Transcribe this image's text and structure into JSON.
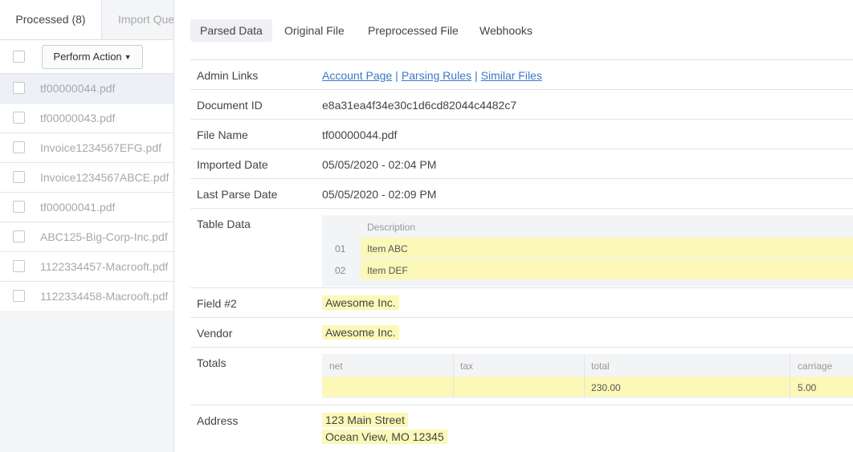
{
  "left": {
    "tabs": {
      "processed": "Processed (8)",
      "import_queue": "Import Queue"
    },
    "perform_action": "Perform Action",
    "files": [
      "tf00000044.pdf",
      "tf00000043.pdf",
      "Invoice1234567EFG.pdf",
      "Invoice1234567ABCE.pdf",
      "tf00000041.pdf",
      "ABC125-Big-Corp-Inc.pdf",
      "1122334457-Macrooft.pdf",
      "1122334458-Macrooft.pdf"
    ]
  },
  "right": {
    "tabs": [
      "Parsed Data",
      "Original File",
      "Preprocessed File",
      "Webhooks"
    ],
    "labels": {
      "admin_links": "Admin Links",
      "document_id": "Document ID",
      "file_name": "File Name",
      "imported_date": "Imported Date",
      "last_parse_date": "Last Parse Date",
      "table_data": "Table Data",
      "field2": "Field #2",
      "vendor": "Vendor",
      "totals": "Totals",
      "address": "Address"
    },
    "admin_links": [
      "Account Page",
      "Parsing Rules",
      "Similar Files"
    ],
    "admin_sep": "|",
    "document_id": "e8a31ea4f34e30c1d6cd82044c4482c7",
    "file_name": "tf00000044.pdf",
    "imported_date": "05/05/2020 - 02:04 PM",
    "last_parse_date": "05/05/2020 - 02:09 PM",
    "table_data": {
      "header": "Description",
      "rows": [
        {
          "num": "01",
          "description": "Item ABC"
        },
        {
          "num": "02",
          "description": "Item DEF"
        }
      ]
    },
    "field2": "Awesome Inc.",
    "vendor": "Awesome Inc.",
    "totals": {
      "headers": [
        "net",
        "tax",
        "total",
        "carriage"
      ],
      "values": [
        "",
        "",
        "230.00",
        "5.00"
      ]
    },
    "address": [
      "123 Main Street",
      "Ocean View, MO 12345"
    ]
  },
  "colors": {
    "highlight": "#fbf8b8",
    "link": "#3a78c8",
    "selected_row": "#eef0f8"
  }
}
